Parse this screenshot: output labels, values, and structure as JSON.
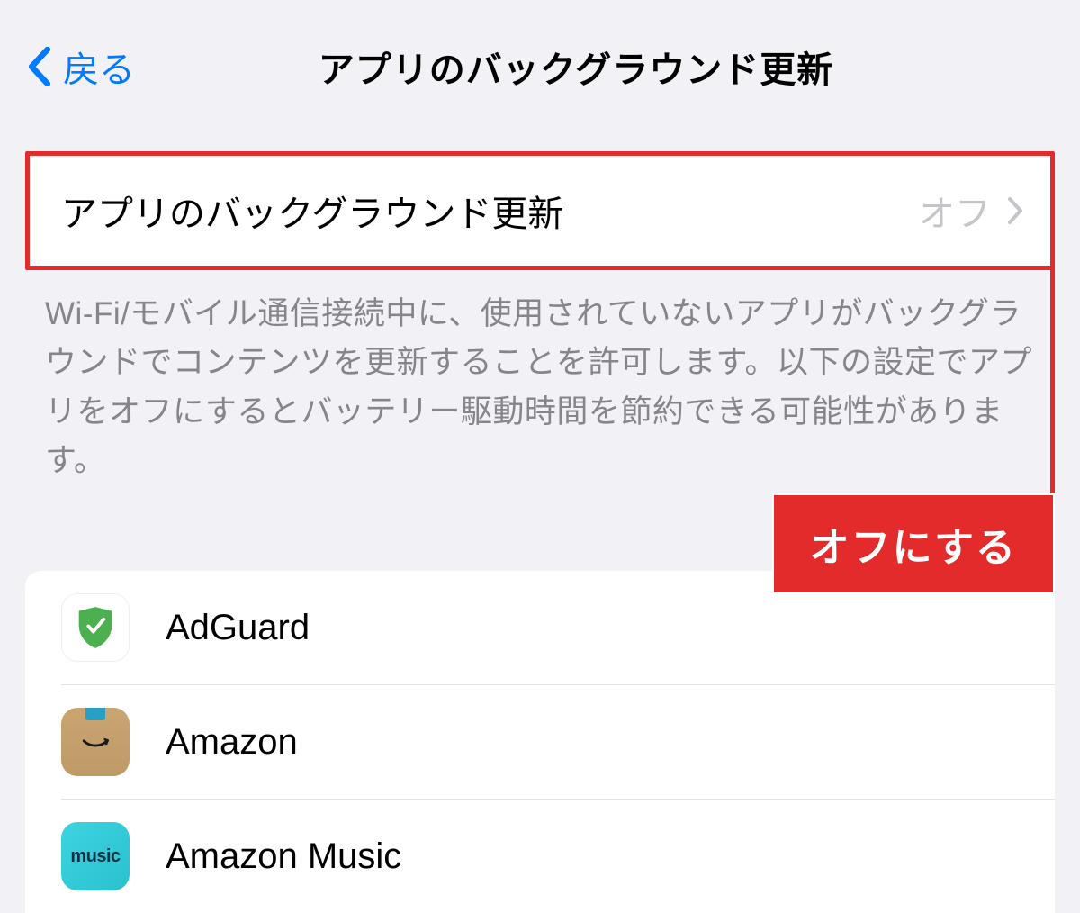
{
  "header": {
    "back_label": "戻る",
    "title": "アプリのバックグラウンド更新"
  },
  "setting": {
    "label": "アプリのバックグラウンド更新",
    "value": "オフ"
  },
  "description": "Wi-Fi/モバイル通信接続中に、使用されていないアプリがバックグラウンドでコンテンツを更新することを許可します。以下の設定でアプリをオフにするとバッテリー駆動時間を節約できる可能性があります。",
  "annotation": "オフにする",
  "apps": [
    {
      "name": "AdGuard",
      "icon": "adguard"
    },
    {
      "name": "Amazon",
      "icon": "amazon"
    },
    {
      "name": "Amazon Music",
      "icon": "amazonmusic"
    }
  ]
}
